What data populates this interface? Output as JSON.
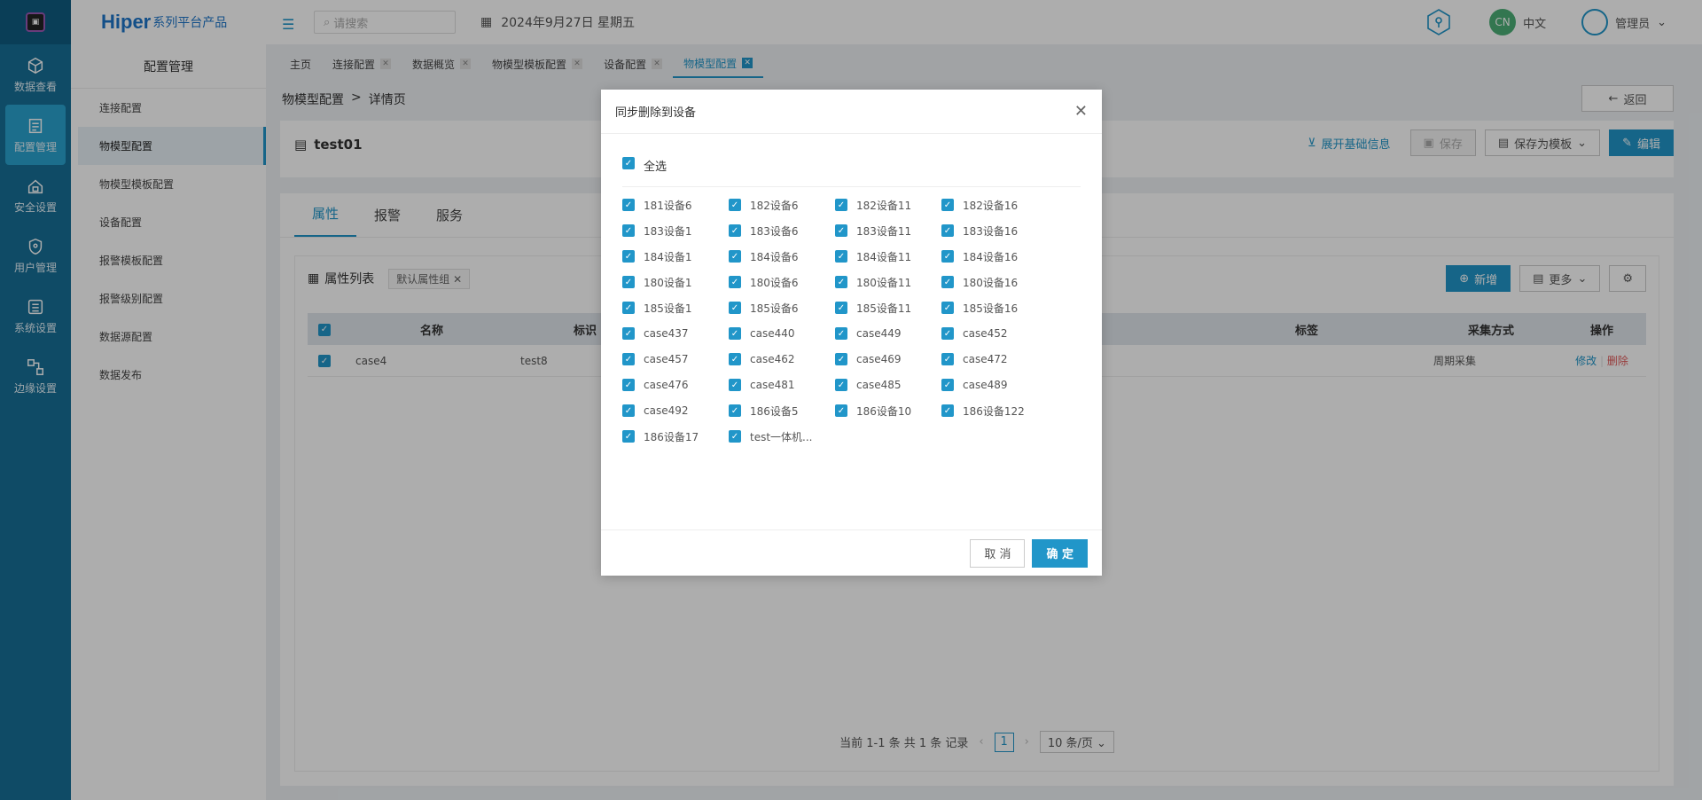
{
  "rail": {
    "items": [
      {
        "label": "数据查看",
        "icon": "cube-icon"
      },
      {
        "label": "配置管理",
        "icon": "config-icon"
      },
      {
        "label": "安全设置",
        "icon": "lock-icon"
      },
      {
        "label": "用户管理",
        "icon": "shield-icon"
      },
      {
        "label": "系统设置",
        "icon": "settings-icon"
      },
      {
        "label": "边缘设置",
        "icon": "edge-icon"
      }
    ]
  },
  "brand": {
    "name": "Hiper",
    "suffix": "系列平台产品"
  },
  "submenu": {
    "title": "配置管理",
    "items": [
      "连接配置",
      "物模型配置",
      "物模型模板配置",
      "设备配置",
      "报警模板配置",
      "报警级别配置",
      "数据源配置",
      "数据发布"
    ]
  },
  "topbar": {
    "search_placeholder": "请搜索",
    "date": "2024年9月27日 星期五",
    "lang_badge": "CN",
    "lang": "中文",
    "user": "管理员"
  },
  "tabs": [
    "主页",
    "连接配置",
    "数据概览",
    "物模型模板配置",
    "设备配置",
    "物模型配置"
  ],
  "breadcrumb": {
    "parent": "物模型配置",
    "sep": ">",
    "current": "详情页"
  },
  "back_label": "返回",
  "header": {
    "title": "test01",
    "expand": "展开基础信息",
    "save": "保存",
    "save_template": "保存为模板",
    "edit": "编辑"
  },
  "inner_tabs": [
    "属性",
    "报警",
    "服务"
  ],
  "list": {
    "title": "属性列表",
    "group": "默认属性组",
    "add": "新增",
    "more": "更多",
    "columns": [
      "名称",
      "标识",
      "标签",
      "采集方式",
      "操作"
    ],
    "rows": [
      {
        "name": "case4",
        "id": "test8",
        "mode": "周期采集",
        "edit": "修改",
        "delete": "删除"
      }
    ]
  },
  "pager": {
    "summary": "当前 1-1 条 共 1 条 记录",
    "page": "1",
    "size": "10 条/页"
  },
  "modal": {
    "title": "同步删除到设备",
    "select_all": "全选",
    "devices": [
      "181设备6",
      "182设备6",
      "182设备11",
      "182设备16",
      "183设备1",
      "183设备6",
      "183设备11",
      "183设备16",
      "184设备1",
      "184设备6",
      "184设备11",
      "184设备16",
      "180设备1",
      "180设备6",
      "180设备11",
      "180设备16",
      "185设备1",
      "185设备6",
      "185设备11",
      "185设备16",
      "case437",
      "case440",
      "case449",
      "case452",
      "case457",
      "case462",
      "case469",
      "case472",
      "case476",
      "case481",
      "case485",
      "case489",
      "case492",
      "186设备5",
      "186设备10",
      "186设备122",
      "186设备17",
      "test一体机..."
    ],
    "cancel": "取 消",
    "confirm": "确 定"
  }
}
